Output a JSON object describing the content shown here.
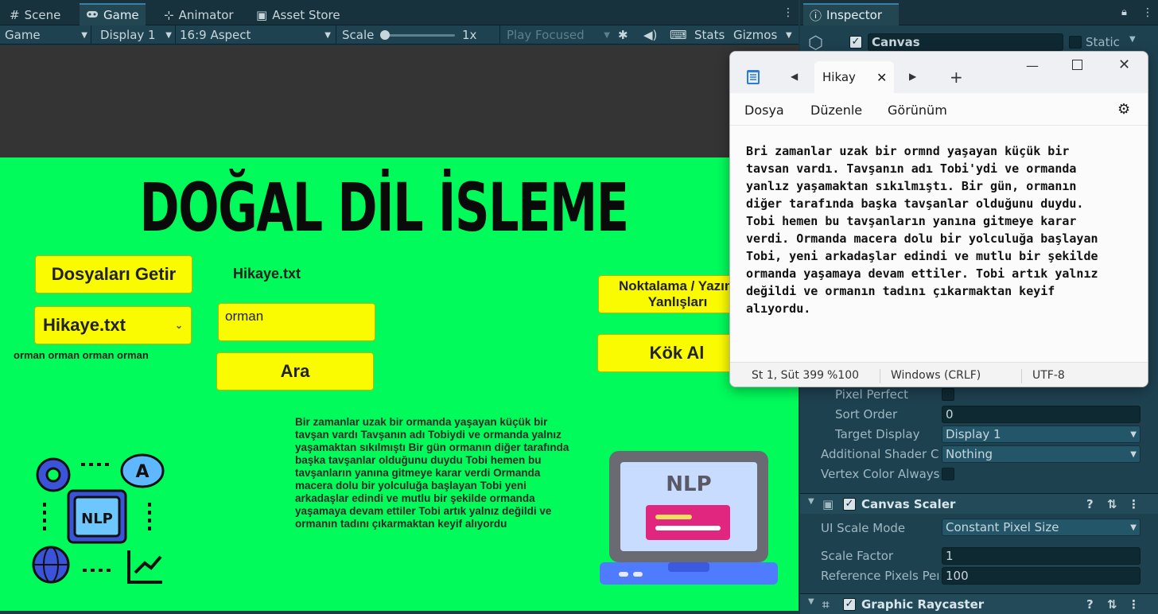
{
  "unity": {
    "tabs": [
      {
        "label": "Scene",
        "icon": "grid-icon"
      },
      {
        "label": "Game",
        "icon": "gamepad-icon"
      },
      {
        "label": "Animator",
        "icon": "animator-icon"
      },
      {
        "label": "Asset Store",
        "icon": "store-icon"
      }
    ],
    "toolbar": {
      "mode": "Game",
      "display": "Display 1",
      "aspect": "16:9 Aspect",
      "scale_label": "Scale",
      "scale_value": "1x",
      "play_focused": "Play Focused",
      "stats": "Stats",
      "gizmos": "Gizmos"
    },
    "inspector": {
      "tab": "Inspector",
      "object_name": "Canvas",
      "static_label": "Static",
      "rows": [
        {
          "label": "Pixel Perfect",
          "type": "check",
          "value": ""
        },
        {
          "label": "Sort Order",
          "type": "field",
          "value": "0"
        },
        {
          "label": "Target Display",
          "type": "drop",
          "value": "Display 1"
        },
        {
          "label": "Additional Shader Ch",
          "type": "drop",
          "value": "Nothing"
        },
        {
          "label": "Vertex Color Always",
          "type": "check",
          "value": ""
        }
      ],
      "scaler": {
        "title": "Canvas Scaler",
        "ui_scale_mode_label": "UI Scale Mode",
        "ui_scale_mode": "Constant Pixel Size",
        "scale_factor_label": "Scale Factor",
        "scale_factor": "1",
        "ref_pixels_label": "Reference Pixels Per",
        "ref_pixels": "100"
      },
      "raycaster_title": "Graphic Raycaster"
    }
  },
  "game": {
    "title": "DOĞAL DİL İSLEME",
    "fetch_button": "Dosyaları Getir",
    "file_label": "Hikaye.txt",
    "dropdown_value": "Hikaye.txt",
    "search_value": "orman",
    "search_button": "Ara",
    "results": "orman orman orman orman",
    "punct_button": "Noktalama / Yazım Yanlışları",
    "root_button": "Kök Al",
    "story": "Bir zamanlar uzak bir ormanda yaşayan küçük bir tavşan vardı Tavşanın adı Tobiydi ve ormanda yalnız yaşamaktan sıkılmıştı Bir gün ormanın diğer tarafında başka tavşanlar olduğunu duydu Tobi hemen bu tavşanların yanına gitmeye karar verdi Ormanda macera dolu bir yolculuğa başlayan Tobi yeni arkadaşlar edindi ve mutlu bir şekilde ormanda yaşamaya devam ettiler Tobi artık yalnız değildi ve ormanın tadını çıkarmaktan keyif alıyordu",
    "nlp_chip_label": "NLP",
    "nlp_bubble_letter": "A",
    "nlp_laptop_label": "NLP"
  },
  "notepad": {
    "tab_title": "Hikay",
    "menu": [
      "Dosya",
      "Düzenle",
      "Görünüm"
    ],
    "text": "Bri zamanlar uzak bir ormnd yaşayan küçük bir\ntavsan vardı. Tavşanın adı Tobi'ydi ve ormanda\nyanlız yaşamaktan sıkılmıştı. Bir gün, ormanın\ndiğer tarafında başka tavşanlar olduğunu duydu.\nTobi hemen bu tavşanların yanına gitmeye karar\nverdi. Ormanda macera dolu bir yolculuğa başlayan\nTobi, yeni arkadaşlar edindi ve mutlu bir şekilde\normanda yaşamaya devam ettiler. Tobi artık yalnız\ndeğildi ve ormanın tadını çıkarmaktan keyif\nalıyordu.",
    "status": {
      "position": "St 1, Süt 399",
      "zoom": "%100",
      "line_endings": "Windows (CRLF)",
      "encoding": "UTF-8"
    }
  }
}
